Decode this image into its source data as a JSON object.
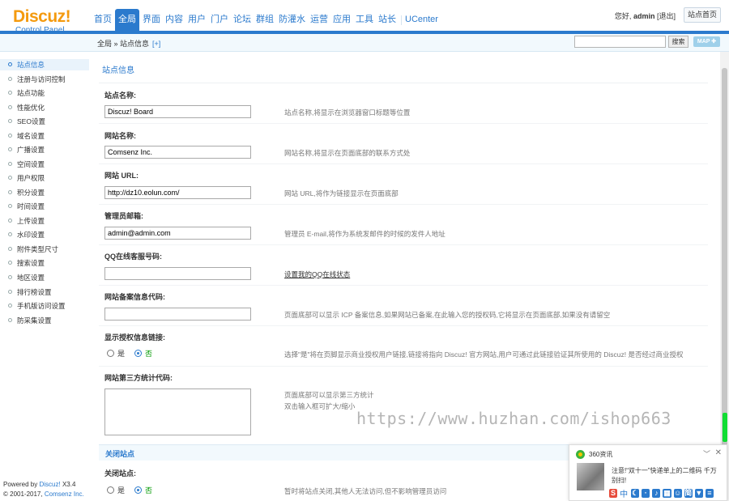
{
  "header": {
    "logo_main": "Discuz!",
    "logo_sub": "Control Panel",
    "nav": [
      "首页",
      "全局",
      "界面",
      "内容",
      "用户",
      "门户",
      "论坛",
      "群组",
      "防灌水",
      "运营",
      "应用",
      "工具",
      "站长",
      "UCenter"
    ],
    "active_nav_index": 1,
    "greeting": "您好,",
    "username": "admin",
    "logout": "[退出]",
    "home_button": "站点首页"
  },
  "breadcrumb": {
    "text": "全局 » 站点信息",
    "add": "[+]"
  },
  "search": {
    "button": "搜索",
    "map": "MAP ✚"
  },
  "sidebar": {
    "items": [
      "站点信息",
      "注册与访问控制",
      "站点功能",
      "性能优化",
      "SEO设置",
      "域名设置",
      "广播设置",
      "空间设置",
      "用户权限",
      "积分设置",
      "时间设置",
      "上传设置",
      "水印设置",
      "附件类型尺寸",
      "搜索设置",
      "地区设置",
      "排行榜设置",
      "手机版访问设置",
      "防采集设置"
    ],
    "active_index": 0
  },
  "footer": {
    "powered_prefix": "Powered by",
    "powered_link": "Discuz!",
    "version": "X3.4",
    "copyright_prefix": "© 2001-2017,",
    "copyright_link": "Comsenz Inc."
  },
  "main": {
    "title": "站点信息",
    "fields": [
      {
        "label": "站点名称:",
        "value": "Discuz! Board",
        "desc": "站点名称,将显示在浏览器窗口标题等位置"
      },
      {
        "label": "网站名称:",
        "value": "Comsenz Inc.",
        "desc": "网站名称,将显示在页面底部的联系方式处"
      },
      {
        "label": "网站 URL:",
        "value": "http://dz10.eolun.com/",
        "desc": "网站 URL,将作为链接显示在页面底部"
      },
      {
        "label": "管理员邮箱:",
        "value": "admin@admin.com",
        "desc": "管理员 E-mail,将作为系统发邮件的时候的发件人地址"
      },
      {
        "label": "QQ在线客服号码:",
        "value": "",
        "desc": "设置我的QQ在线状态"
      },
      {
        "label": "网站备案信息代码:",
        "value": "",
        "desc": "页面底部可以显示 ICP 备案信息,如果网站已备案,在此输入您的授权码,它将显示在页面底部,如果没有请留空"
      }
    ],
    "license": {
      "label": "显示授权信息链接:",
      "yes": "是",
      "no": "否",
      "desc": "选择\"是\"将在页脚显示商业授权用户链接,链接将指向 Discuz! 官方网站,用户可通过此链接验证其所使用的 Discuz! 是否经过商业授权"
    },
    "stats": {
      "label": "网站第三方统计代码:",
      "desc1": "页面底部可以显示第三方统计",
      "desc2": "双击输入框可扩大/缩小"
    },
    "close_section": {
      "title": "关闭站点",
      "label": "关闭站点:",
      "yes": "是",
      "no": "否",
      "desc": "暂时将站点关闭,其他人无法访问,但不影响管理员访问"
    }
  },
  "watermark": "https://www.huzhan.com/ishop663",
  "popup": {
    "source": "360资讯",
    "text": "注意!“双十一”快递单上的二维码 千万别扫!",
    "bar_label": "中"
  }
}
